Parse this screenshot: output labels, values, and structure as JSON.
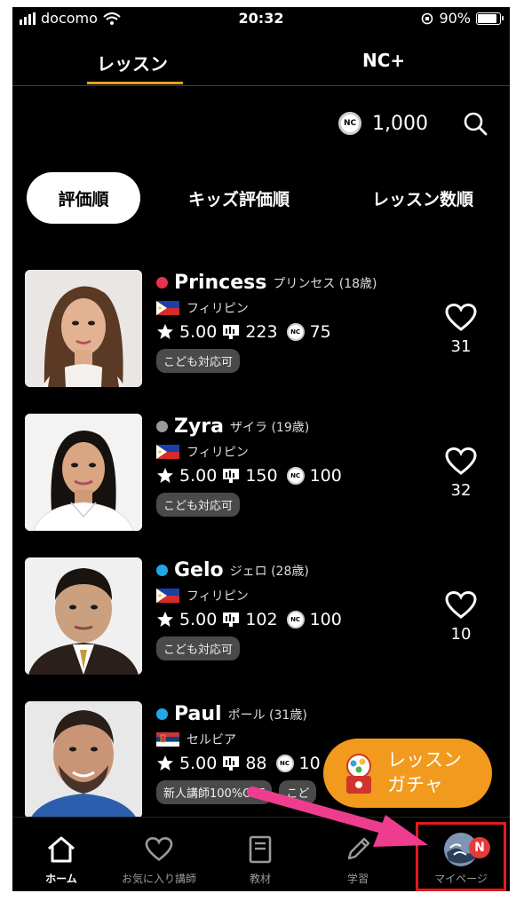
{
  "status_bar": {
    "carrier": "docomo",
    "time": "20:32",
    "battery": "90%",
    "battery_level": 0.9
  },
  "tabs": [
    {
      "label": "レッスン",
      "active": true
    },
    {
      "label": "NC+",
      "active": false
    }
  ],
  "coins": {
    "icon_text": "NC",
    "value": "1,000"
  },
  "sort_options": [
    {
      "label": "評価順",
      "active": true
    },
    {
      "label": "キッズ評価順",
      "active": false
    },
    {
      "label": "レッスン数順",
      "active": false
    }
  ],
  "teachers": [
    {
      "name": "Princess",
      "kana": "プリンセス (18歳)",
      "status_color": "#e8324f",
      "country": "フィリピン",
      "flag": "philippines",
      "rating": "5.00",
      "lessons": "223",
      "coins": "75",
      "badges": [
        "こども対応可"
      ],
      "favorites": "31"
    },
    {
      "name": "Zyra",
      "kana": "ザイラ (19歳)",
      "status_color": "#9a9a9a",
      "country": "フィリピン",
      "flag": "philippines",
      "rating": "5.00",
      "lessons": "150",
      "coins": "100",
      "badges": [
        "こども対応可"
      ],
      "favorites": "32"
    },
    {
      "name": "Gelo",
      "kana": "ジェロ (28歳)",
      "status_color": "#21a7e8",
      "country": "フィリピン",
      "flag": "philippines",
      "rating": "5.00",
      "lessons": "102",
      "coins": "100",
      "badges": [
        "こども対応可"
      ],
      "favorites": "10"
    },
    {
      "name": "Paul",
      "kana": "ポール (31歳)",
      "status_color": "#21a7e8",
      "country": "セルビア",
      "flag": "serbia",
      "rating": "5.00",
      "lessons": "88",
      "coins": "10",
      "badges": [
        "新人講師100%OFF",
        "こど"
      ],
      "favorites": ""
    }
  ],
  "gacha": {
    "label_line1": "レッスン",
    "label_line2": "ガチャ"
  },
  "bottom_nav": [
    {
      "label": "ホーム",
      "icon": "home-icon",
      "active": true
    },
    {
      "label": "お気に入り講師",
      "icon": "heart-icon",
      "active": false
    },
    {
      "label": "教材",
      "icon": "book-icon",
      "active": false
    },
    {
      "label": "学習",
      "icon": "pencil-icon",
      "active": false
    },
    {
      "label": "マイページ",
      "icon": "avatar",
      "active": false,
      "badge": "N"
    }
  ],
  "colors": {
    "accent": "#e8a020",
    "gacha": "#f29a1d",
    "highlight_box": "#e21b1b",
    "arrow": "#ee3d8f"
  }
}
